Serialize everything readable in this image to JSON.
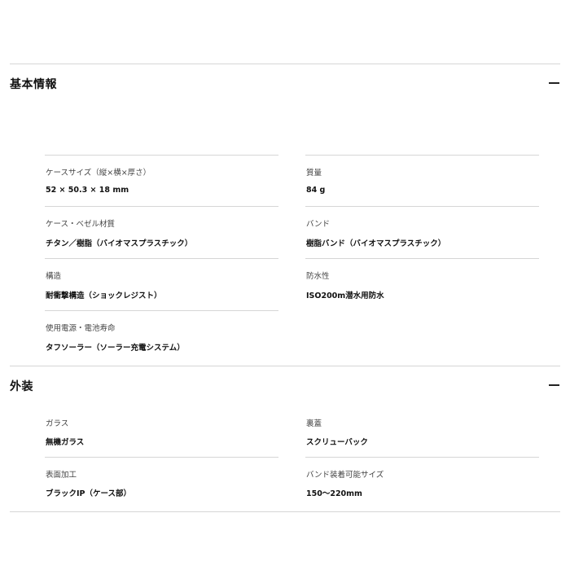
{
  "sections": [
    {
      "title": "基本情報",
      "toggle_label": "−",
      "specs": [
        {
          "label": "ケースサイズ（縦×横×厚さ）",
          "value": "52 × 50.3 × 18 mm"
        },
        {
          "label": "質量",
          "value": "84 g"
        },
        {
          "label": "ケース・ベゼル材質",
          "value": "チタン／樹脂（バイオマスプラスチック）"
        },
        {
          "label": "バンド",
          "value": "樹脂バンド（バイオマスプラスチック）"
        },
        {
          "label": "構造",
          "value": "耐衝撃構造（ショックレジスト）"
        },
        {
          "label": "防水性",
          "value": "ISO200m潜水用防水"
        },
        {
          "label": "使用電源・電池寿命",
          "value": "タフソーラー（ソーラー充電システム）"
        }
      ]
    },
    {
      "title": "外装",
      "toggle_label": "−",
      "specs": [
        {
          "label": "ガラス",
          "value": "無機ガラス"
        },
        {
          "label": "裏蓋",
          "value": "スクリューバック"
        },
        {
          "label": "表面加工",
          "value": "ブラックIP（ケース部）"
        },
        {
          "label": "バンド装着可能サイズ",
          "value": "150〜220mm"
        }
      ]
    }
  ]
}
